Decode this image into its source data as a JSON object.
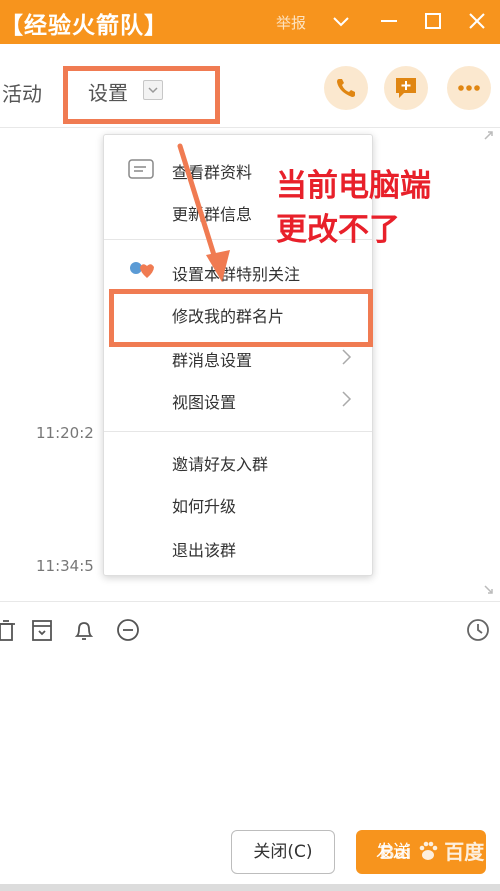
{
  "window": {
    "title": "【经验火箭队】",
    "report_label": "举报",
    "icons": [
      "chevron-down-icon",
      "minimize-icon",
      "maximize-icon",
      "close-icon"
    ]
  },
  "toolbar": {
    "tab_activity": "活动",
    "tab_settings": "设置",
    "buttons": [
      "phone-icon",
      "add-chat-icon",
      "more-icon"
    ]
  },
  "menu": {
    "items": [
      {
        "label": "查看群资料",
        "icon": "profile-card-icon",
        "has_arrow": false
      },
      {
        "label": "更新群信息",
        "has_arrow": false
      },
      {
        "label": "设置本群特别关注",
        "icon": "special-care-icon",
        "has_arrow": false
      },
      {
        "label": "修改我的群名片",
        "has_arrow": false,
        "highlighted": true
      },
      {
        "label": "群消息设置",
        "has_arrow": true
      },
      {
        "label": "视图设置",
        "has_arrow": true
      },
      {
        "label": "邀请好友入群",
        "has_arrow": false
      },
      {
        "label": "如何升级",
        "has_arrow": false
      },
      {
        "label": "退出该群",
        "has_arrow": false
      }
    ]
  },
  "annotation": {
    "line1": "当前电脑端",
    "line2": "更改不了",
    "color": "#e8202a"
  },
  "chat": {
    "timestamps": [
      "11:20:2",
      "11:34:5"
    ]
  },
  "input_toolbar": {
    "icons": [
      "trash-icon",
      "archive-icon",
      "bell-icon",
      "minus-circle-icon",
      "clock-icon"
    ]
  },
  "footer": {
    "close_label": "关闭(C)",
    "send_label": "发送"
  },
  "watermark": {
    "brand": "Bai",
    "brand_suffix": "百度",
    "sub": "经验"
  },
  "colors": {
    "accent": "#f7941d",
    "highlight_box": "#f07b52"
  }
}
